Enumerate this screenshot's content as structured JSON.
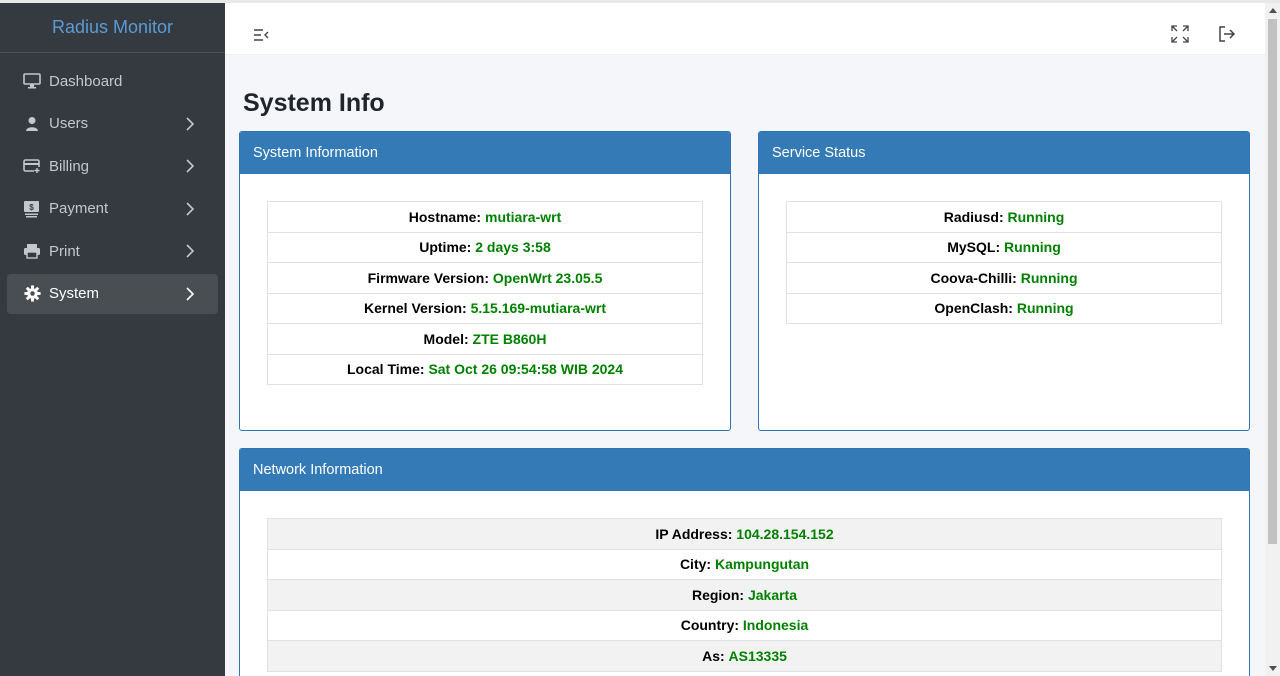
{
  "app": {
    "brand": "Radius Monitor"
  },
  "sidebar": {
    "items": [
      {
        "label": "Dashboard",
        "icon": "monitor-icon",
        "has_children": false,
        "active": false
      },
      {
        "label": "Users",
        "icon": "user-icon",
        "has_children": true,
        "active": false
      },
      {
        "label": "Billing",
        "icon": "credit-card-icon",
        "has_children": true,
        "active": false
      },
      {
        "label": "Payment",
        "icon": "money-icon",
        "has_children": true,
        "active": false
      },
      {
        "label": "Print",
        "icon": "printer-icon",
        "has_children": true,
        "active": false
      },
      {
        "label": "System",
        "icon": "gear-icon",
        "has_children": true,
        "active": true
      }
    ]
  },
  "topbar": {
    "icons": [
      "menu-collapse-icon",
      "fullscreen-icon",
      "logout-icon"
    ]
  },
  "page": {
    "title": "System Info"
  },
  "system_info": {
    "title": "System Information",
    "rows": [
      {
        "label": "Hostname:",
        "value": "mutiara-wrt"
      },
      {
        "label": "Uptime:",
        "value": "2 days 3:58"
      },
      {
        "label": "Firmware Version:",
        "value": "OpenWrt 23.05.5"
      },
      {
        "label": "Kernel Version:",
        "value": "5.15.169-mutiara-wrt"
      },
      {
        "label": "Model:",
        "value": "ZTE B860H"
      },
      {
        "label": "Local Time:",
        "value": "Sat Oct 26 09:54:58 WIB 2024"
      }
    ]
  },
  "service_status": {
    "title": "Service Status",
    "rows": [
      {
        "label": "Radiusd:",
        "value": "Running"
      },
      {
        "label": "MySQL:",
        "value": "Running"
      },
      {
        "label": "Coova-Chilli:",
        "value": "Running"
      },
      {
        "label": "OpenClash:",
        "value": "Running"
      }
    ]
  },
  "network_info": {
    "title": "Network Information",
    "rows": [
      {
        "label": "IP Address:",
        "value": "104.28.154.152"
      },
      {
        "label": "City:",
        "value": "Kampungutan"
      },
      {
        "label": "Region:",
        "value": "Jakarta"
      },
      {
        "label": "Country:",
        "value": "Indonesia"
      },
      {
        "label": "As:",
        "value": "AS13335"
      }
    ]
  },
  "colors": {
    "sidebar_bg": "#343a40",
    "brand_text": "#5b9bd5",
    "card_header": "#337ab7",
    "value_green": "#008000"
  }
}
